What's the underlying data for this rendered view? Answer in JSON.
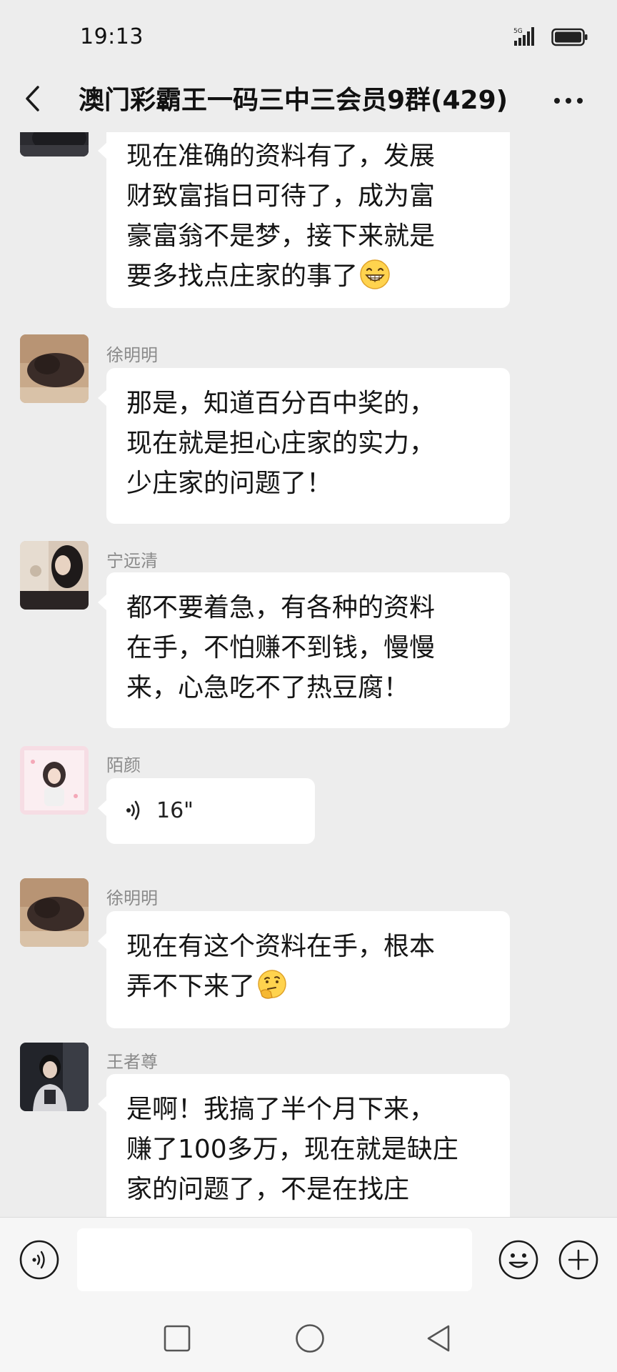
{
  "status_bar": {
    "time": "19:13",
    "network": "5G",
    "signal_icon": "signal-bars-icon",
    "battery_icon": "battery-icon"
  },
  "header": {
    "title": "澳门彩霸王一码三中三会员9群(429)",
    "back_icon": "chevron-left-icon",
    "more_icon": "more-dots-icon"
  },
  "messages": [
    {
      "sender": "",
      "text": "现在准确的资料有了，发展\n财致富指日可待了，成为富\n豪富翁不是梦，接下来就是\n要多找点庄家的事了",
      "emoji": "grin-emoji"
    },
    {
      "sender": "徐明明",
      "text": "那是，知道百分百中奖的，\n现在就是担心庄家的实力，\n少庄家的问题了！"
    },
    {
      "sender": "宁远清",
      "text": "都不要着急，有各种的资料\n在手，不怕赚不到钱，慢慢\n来，心急吃不了热豆腐！"
    },
    {
      "sender": "陌颜",
      "type": "voice",
      "duration": "16\""
    },
    {
      "sender": "徐明明",
      "text": "现在有这个资料在手，根本\n弄不下来了",
      "emoji": "thinking-emoji"
    },
    {
      "sender": "王者尊",
      "text": "是啊！我搞了半个月下来，\n赚了100多万，现在就是缺庄\n家的问题了，不是在找庄"
    }
  ],
  "input_bar": {
    "placeholder": "",
    "voice_icon": "voice-input-icon",
    "emoji_icon": "smiley-icon",
    "plus_icon": "plus-circle-icon"
  },
  "nav_bar": {
    "icons": [
      "recent-apps-icon",
      "home-icon",
      "back-triangle-icon"
    ]
  },
  "colors": {
    "background": "#ededed",
    "bubble": "#ffffff",
    "sender_name": "#8a8a8a",
    "input_bar": "#f6f6f6"
  }
}
